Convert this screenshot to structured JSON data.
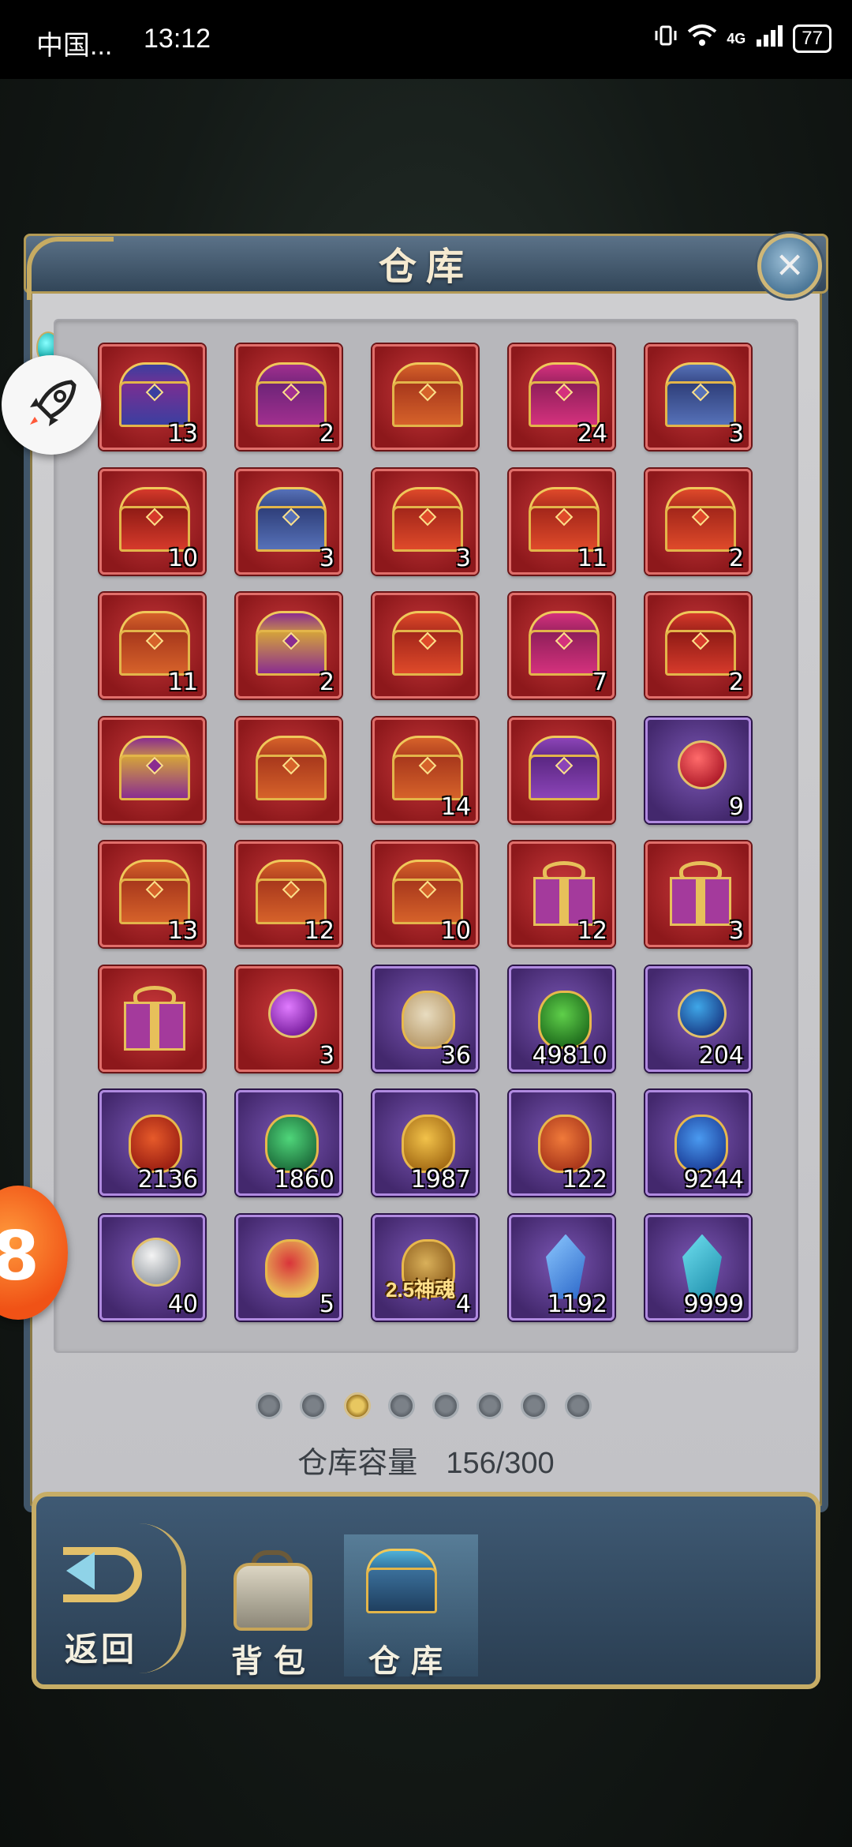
{
  "status_bar": {
    "carrier": "中国...",
    "time": "13:12",
    "network": "4G",
    "battery": "77"
  },
  "panel": {
    "title": "仓库",
    "close_label": "×"
  },
  "items": [
    {
      "count": "13",
      "bg": "red",
      "icon": "blue-purple-chest-icon",
      "kind": "chest",
      "c1": "#3b3fa0",
      "c2": "#7a2e92"
    },
    {
      "count": "2",
      "bg": "red",
      "icon": "magenta-gold-chest-icon",
      "kind": "chest",
      "c1": "#a12f8f",
      "c2": "#6e2478"
    },
    {
      "count": "",
      "bg": "red",
      "icon": "orange-gold-chest-icon",
      "kind": "chest",
      "c1": "#d6622a",
      "c2": "#a8381c"
    },
    {
      "count": "24",
      "bg": "red",
      "icon": "pink-ornate-chest-icon",
      "kind": "chest",
      "c1": "#d4317d",
      "c2": "#8f1f5a"
    },
    {
      "count": "3",
      "bg": "red",
      "icon": "blue-ornate-chest-icon",
      "kind": "chest",
      "c1": "#5671b8",
      "c2": "#2f3f7a"
    },
    {
      "count": "10",
      "bg": "red",
      "icon": "red-gold-chest-icon",
      "kind": "chest",
      "c1": "#d63a2b",
      "c2": "#8f1b15"
    },
    {
      "count": "3",
      "bg": "red",
      "icon": "blue-ornate-chest-icon",
      "kind": "chest",
      "c1": "#5671b8",
      "c2": "#2f3f7a"
    },
    {
      "count": "3",
      "bg": "red",
      "icon": "red-ornate-chest-icon",
      "kind": "chest",
      "c1": "#df4a2a",
      "c2": "#a3261a"
    },
    {
      "count": "11",
      "bg": "red",
      "icon": "red-ornate-chest-icon",
      "kind": "chest",
      "c1": "#df4a2a",
      "c2": "#a3261a"
    },
    {
      "count": "2",
      "bg": "red",
      "icon": "red-ornate-chest-icon",
      "kind": "chest",
      "c1": "#df4a2a",
      "c2": "#a3261a"
    },
    {
      "count": "11",
      "bg": "red",
      "icon": "orange-gold-chest-icon",
      "kind": "chest",
      "c1": "#d6622a",
      "c2": "#a8381c"
    },
    {
      "count": "2",
      "bg": "red",
      "icon": "purple-gold-chest-icon",
      "kind": "chest",
      "c1": "#8a2d90",
      "c2": "#d4a23b"
    },
    {
      "count": "",
      "bg": "red",
      "icon": "red-ornate-chest-icon",
      "kind": "chest",
      "c1": "#df4a2a",
      "c2": "#a3261a"
    },
    {
      "count": "7",
      "bg": "red",
      "icon": "pink-ornate-chest-icon",
      "kind": "chest",
      "c1": "#d4317d",
      "c2": "#8f1f5a"
    },
    {
      "count": "2",
      "bg": "red",
      "icon": "red-chest-with-puzzle-icon",
      "kind": "chest",
      "c1": "#d63a2b",
      "c2": "#8f1b15"
    },
    {
      "count": "",
      "bg": "red",
      "icon": "purple-gold-chest-icon",
      "kind": "chest",
      "c1": "#8a2d90",
      "c2": "#d4a23b"
    },
    {
      "count": "",
      "bg": "red",
      "icon": "orange-gold-chest-icon",
      "kind": "chest",
      "c1": "#d6622a",
      "c2": "#a8381c"
    },
    {
      "count": "14",
      "bg": "red",
      "icon": "orange-gold-chest-icon",
      "kind": "chest",
      "c1": "#d6622a",
      "c2": "#a8381c"
    },
    {
      "count": "",
      "bg": "red",
      "icon": "purple-round-chest-icon",
      "kind": "chest",
      "c1": "#8c44b8",
      "c2": "#5a2782"
    },
    {
      "count": "9",
      "bg": "purple",
      "icon": "red-star-puzzle-icon",
      "kind": "orb",
      "c1": "#ff6b6b",
      "c2": "#b01c2a"
    },
    {
      "count": "13",
      "bg": "red",
      "icon": "orange-gold-chest-icon",
      "kind": "chest",
      "c1": "#d6622a",
      "c2": "#a8381c"
    },
    {
      "count": "12",
      "bg": "red",
      "icon": "orange-gold-chest-icon",
      "kind": "chest",
      "c1": "#d6622a",
      "c2": "#a8381c"
    },
    {
      "count": "10",
      "bg": "red",
      "icon": "orange-gold-chest-icon",
      "kind": "chest",
      "c1": "#d6622a",
      "c2": "#a8381c"
    },
    {
      "count": "12",
      "bg": "red",
      "icon": "gift-box-icon",
      "kind": "gift",
      "c1": "#a43a9c",
      "c2": "#e7c05a"
    },
    {
      "count": "3",
      "bg": "red",
      "icon": "gift-box-icon",
      "kind": "gift",
      "c1": "#a43a9c",
      "c2": "#e7c05a"
    },
    {
      "count": "",
      "bg": "red",
      "icon": "gift-box-icon",
      "kind": "gift",
      "c1": "#a43a9c",
      "c2": "#e7c05a"
    },
    {
      "count": "3",
      "bg": "red",
      "icon": "purple-orb-icon",
      "kind": "orb",
      "c1": "#e07bff",
      "c2": "#7a1fa0"
    },
    {
      "count": "36",
      "bg": "purple",
      "icon": "scroll-icon",
      "kind": "stone",
      "c1": "#e8dcc0",
      "c2": "#b89a6a"
    },
    {
      "count": "49810",
      "bg": "purple",
      "icon": "green-gem-icon",
      "kind": "stone",
      "c1": "#5fcf4a",
      "c2": "#1e6b1c"
    },
    {
      "count": "204",
      "bg": "purple",
      "icon": "blue-ring-icon",
      "kind": "orb",
      "c1": "#3fa7e8",
      "c2": "#1a3f8a"
    },
    {
      "count": "2136",
      "bg": "purple",
      "icon": "red-rune-stone-icon",
      "kind": "stone",
      "c1": "#e65a2a",
      "c2": "#9a1e12"
    },
    {
      "count": "1860",
      "bg": "purple",
      "icon": "green-leaf-crystal-icon",
      "kind": "stone",
      "c1": "#4fd67a",
      "c2": "#1c6b3a"
    },
    {
      "count": "1987",
      "bg": "purple",
      "icon": "gold-rune-stone-icon",
      "kind": "stone",
      "c1": "#f2c24a",
      "c2": "#a36a14"
    },
    {
      "count": "122",
      "bg": "purple",
      "icon": "orange-rune-stone-icon",
      "kind": "stone",
      "c1": "#f07a3a",
      "c2": "#a8351a"
    },
    {
      "count": "9244",
      "bg": "purple",
      "icon": "blue-trident-crystal-icon",
      "kind": "stone",
      "c1": "#4a9af0",
      "c2": "#1c3f9a"
    },
    {
      "count": "40",
      "bg": "purple",
      "icon": "pocket-watch-icon",
      "kind": "orb",
      "c1": "#f4f4f4",
      "c2": "#9aa0a6"
    },
    {
      "count": "5",
      "bg": "purple",
      "icon": "gender-card-icon",
      "kind": "stone",
      "c1": "#d9343a",
      "c2": "#e8c05a"
    },
    {
      "count": "4",
      "bg": "purple",
      "icon": "soul-sword-icon",
      "kind": "stone",
      "c1": "#d9b05a",
      "c2": "#8a5a1a",
      "label": "2.5神魂"
    },
    {
      "count": "1192",
      "bg": "purple",
      "icon": "blue-crystal-icon",
      "kind": "crystal",
      "c1": "#8cc8ff",
      "c2": "#2a66c8"
    },
    {
      "count": "9999",
      "bg": "purple",
      "icon": "cyan-crystal-icon",
      "kind": "crystal",
      "c1": "#6fe0f0",
      "c2": "#1a8aa8"
    }
  ],
  "pagination": {
    "pages": 8,
    "current": 3
  },
  "capacity": {
    "label": "仓库容量",
    "value": "156/300"
  },
  "bottom": {
    "return_label": "返回",
    "tabs": [
      {
        "label": "背包",
        "active": false
      },
      {
        "label": "仓库",
        "active": true
      }
    ]
  },
  "floating": {
    "badge_number": "8"
  },
  "colors": {
    "panel_frame": "#41566a",
    "gold_trim": "#c7ad66",
    "slot_red": "#a72426",
    "slot_purple": "#5a3590"
  }
}
